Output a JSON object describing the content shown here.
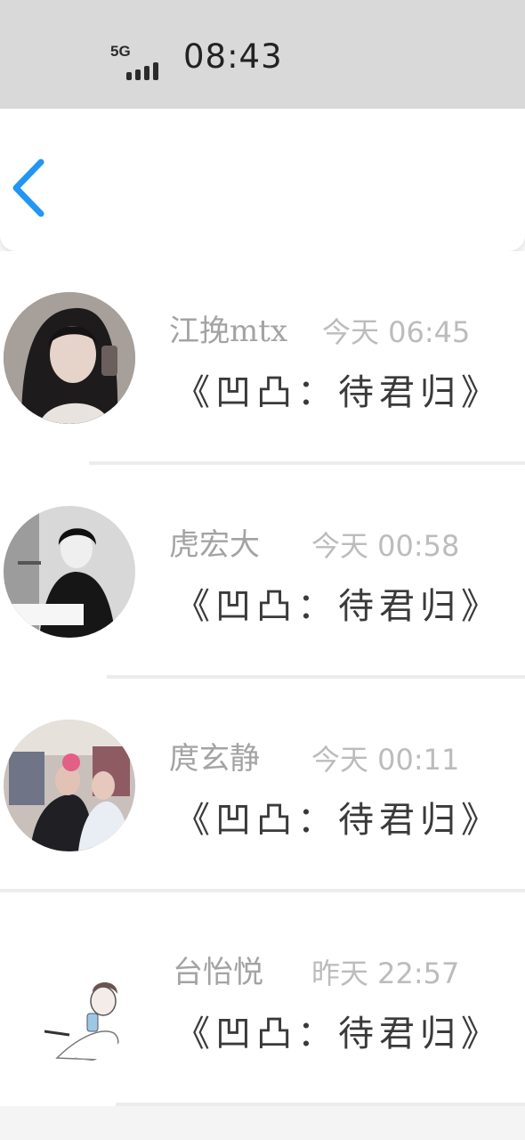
{
  "status_bar": {
    "network": "5G",
    "time": "08:43",
    "signal_icon": "signal-bars-icon"
  },
  "nav": {
    "back_icon": "chevron-left-icon",
    "accent_color": "#2196f3"
  },
  "messages": [
    {
      "name": "江挽mtx",
      "time": "今天 06:45",
      "text": "《凹凸：待君归》",
      "avatar": "avatar-portrait-dark-hair"
    },
    {
      "name": "虎宏大",
      "time": "今天 00:58",
      "text": "《凹凸：待君归》",
      "avatar": "avatar-bw-portrait-cigarette"
    },
    {
      "name": "庹玄静",
      "time": "今天 00:11",
      "text": "《凹凸：待君归》",
      "avatar": "avatar-two-people-photo"
    },
    {
      "name": "台怡悦",
      "time": "昨天 22:57",
      "text": "《凹凸：待君归》",
      "avatar": "avatar-sketch-girl-drink"
    }
  ]
}
